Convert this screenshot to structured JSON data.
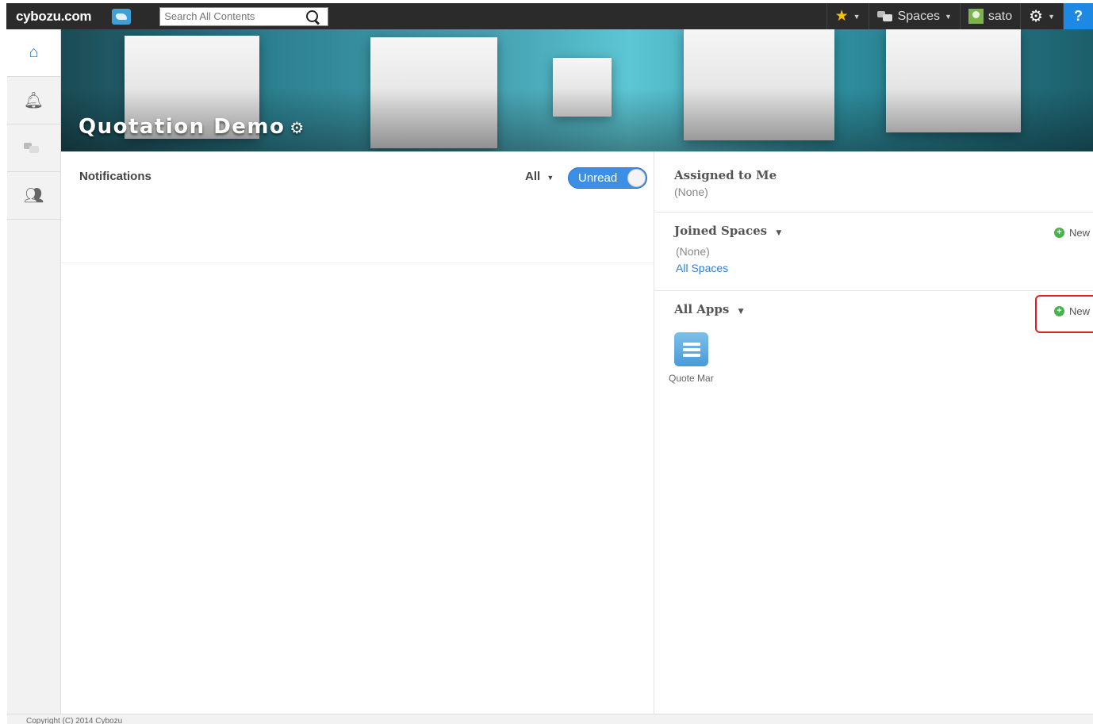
{
  "topbar": {
    "logo": "cybozu.com",
    "search_placeholder": "Search All Contents",
    "spaces_label": "Spaces",
    "user_name": "sato",
    "help_label": "?"
  },
  "banner": {
    "title": "Quotation Demo"
  },
  "notifications": {
    "title": "Notifications",
    "filter_label": "All",
    "toggle_label": "Unread"
  },
  "assigned": {
    "title": "Assigned to Me",
    "empty": "(None)"
  },
  "joined_spaces": {
    "title": "Joined Spaces",
    "empty": "(None)",
    "all_link": "All Spaces",
    "new_label": "New"
  },
  "all_apps": {
    "title": "All Apps",
    "new_label": "New",
    "apps": [
      {
        "name": "Quote Mar"
      }
    ]
  },
  "footer": {
    "copyright": "Copyright (C) 2014 Cybozu"
  },
  "icons": {
    "sidebar": [
      "home-icon",
      "bell-icon",
      "spaces-icon",
      "people-icon"
    ]
  },
  "colors": {
    "accent": "#2e80d0",
    "toggle": "#3d8ee6",
    "new_plus": "#4caf50",
    "highlight": "#e02020"
  }
}
